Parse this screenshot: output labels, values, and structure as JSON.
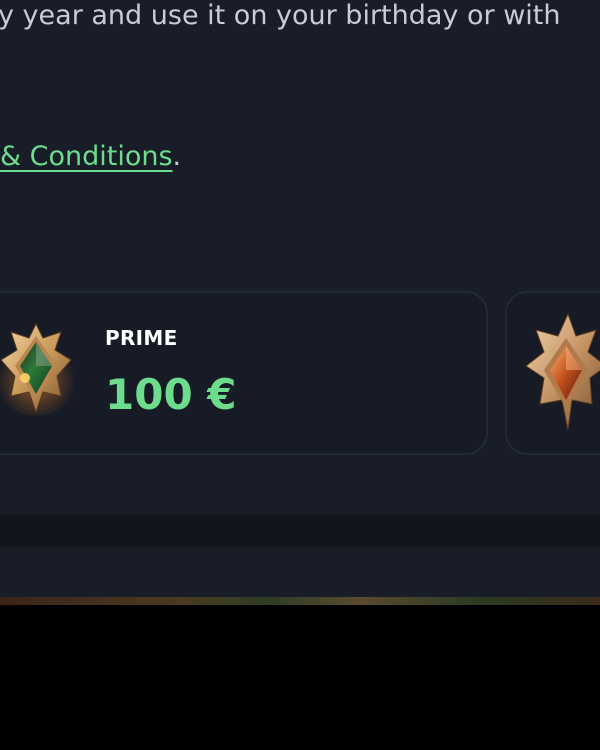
{
  "intro": {
    "text": "y year and use it on your birthday or with"
  },
  "terms": {
    "link_label": "& Conditions",
    "suffix": "."
  },
  "tiers": [
    {
      "name": "PRIME",
      "amount": "100 €",
      "badge_icon": "green-gem-crown-badge-icon"
    },
    {
      "name": "",
      "amount": "",
      "badge_icon": "orange-gem-crown-badge-icon"
    }
  ],
  "colors": {
    "accent": "#6ddc8c",
    "background": "#181d28",
    "card": "#161b25",
    "text": "#c8ccd4"
  }
}
